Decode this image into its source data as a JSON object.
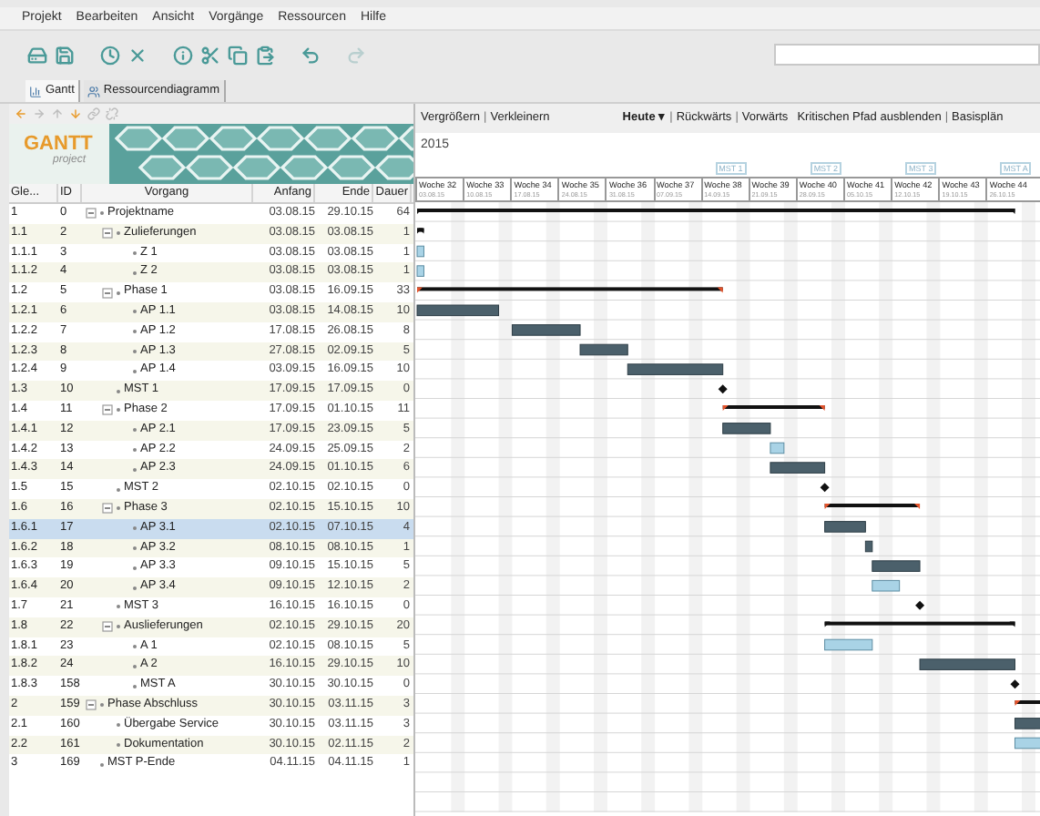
{
  "menu": [
    "Projekt",
    "Bearbeiten",
    "Ansicht",
    "Vorgänge",
    "Ressourcen",
    "Hilfe"
  ],
  "toolbar": [
    {
      "kind": "save-all",
      "disabled": false
    },
    {
      "kind": "save",
      "disabled": false
    },
    {
      "kind": "clock",
      "disabled": false
    },
    {
      "kind": "delete",
      "disabled": false
    },
    {
      "kind": "info",
      "disabled": false
    },
    {
      "kind": "cut",
      "disabled": false
    },
    {
      "kind": "copy",
      "disabled": false
    },
    {
      "kind": "paste",
      "disabled": false
    },
    {
      "kind": "undo",
      "disabled": false
    },
    {
      "kind": "redo",
      "disabled": true
    }
  ],
  "tabs": [
    {
      "label": "Gantt",
      "kind": "gantt",
      "selected": true
    },
    {
      "label": "Ressourcendiagramm",
      "kind": "resource",
      "selected": false
    }
  ],
  "tree_toolbar": [
    {
      "kind": "outdent",
      "disabled": false
    },
    {
      "kind": "indent",
      "disabled": true
    },
    {
      "kind": "up",
      "disabled": true
    },
    {
      "kind": "down",
      "disabled": false
    },
    {
      "kind": "link",
      "disabled": true
    },
    {
      "kind": "unlink",
      "disabled": true
    }
  ],
  "logo": {
    "title": "GANTT",
    "subtitle": "project"
  },
  "table": {
    "columns": [
      "Gle...",
      "ID",
      "Vorgang",
      "Anfang",
      "Ende",
      "Dauer"
    ],
    "rows": [
      {
        "wbs": "1",
        "id": "0",
        "name": "Projektname",
        "start": "03.08.15",
        "end": "29.10.15",
        "duration": "64",
        "kind": "summary",
        "critical": false,
        "expanded": true,
        "selected": false,
        "children": [
          {
            "wbs": "1.1",
            "id": "2",
            "name": "Zulieferungen",
            "start": "03.08.15",
            "end": "03.08.15",
            "duration": "1",
            "kind": "summary",
            "critical": false,
            "expanded": true,
            "selected": false,
            "children": [
              {
                "wbs": "1.1.1",
                "id": "3",
                "name": "Z 1",
                "start": "03.08.15",
                "end": "03.08.15",
                "duration": "1",
                "kind": "task",
                "critical": false,
                "selected": false
              },
              {
                "wbs": "1.1.2",
                "id": "4",
                "name": "Z 2",
                "start": "03.08.15",
                "end": "03.08.15",
                "duration": "1",
                "kind": "task",
                "critical": false,
                "selected": false
              }
            ]
          },
          {
            "wbs": "1.2",
            "id": "5",
            "name": "Phase 1",
            "start": "03.08.15",
            "end": "16.09.15",
            "duration": "33",
            "kind": "summary",
            "critical": true,
            "expanded": true,
            "selected": false,
            "children": [
              {
                "wbs": "1.2.1",
                "id": "6",
                "name": "AP 1.1",
                "start": "03.08.15",
                "end": "14.08.15",
                "duration": "10",
                "kind": "task",
                "critical": true,
                "selected": false
              },
              {
                "wbs": "1.2.2",
                "id": "7",
                "name": "AP 1.2",
                "start": "17.08.15",
                "end": "26.08.15",
                "duration": "8",
                "kind": "task",
                "critical": true,
                "selected": false
              },
              {
                "wbs": "1.2.3",
                "id": "8",
                "name": "AP 1.3",
                "start": "27.08.15",
                "end": "02.09.15",
                "duration": "5",
                "kind": "task",
                "critical": true,
                "selected": false
              },
              {
                "wbs": "1.2.4",
                "id": "9",
                "name": "AP 1.4",
                "start": "03.09.15",
                "end": "16.09.15",
                "duration": "10",
                "kind": "task",
                "critical": true,
                "selected": false
              }
            ]
          },
          {
            "wbs": "1.3",
            "id": "10",
            "name": "MST 1",
            "start": "17.09.15",
            "end": "17.09.15",
            "duration": "0",
            "kind": "milestone",
            "critical": true,
            "selected": false
          },
          {
            "wbs": "1.4",
            "id": "11",
            "name": "Phase 2",
            "start": "17.09.15",
            "end": "01.10.15",
            "duration": "11",
            "kind": "summary",
            "critical": true,
            "expanded": true,
            "selected": false,
            "children": [
              {
                "wbs": "1.4.1",
                "id": "12",
                "name": "AP 2.1",
                "start": "17.09.15",
                "end": "23.09.15",
                "duration": "5",
                "kind": "task",
                "critical": true,
                "selected": false
              },
              {
                "wbs": "1.4.2",
                "id": "13",
                "name": "AP 2.2",
                "start": "24.09.15",
                "end": "25.09.15",
                "duration": "2",
                "kind": "task",
                "critical": false,
                "selected": false
              },
              {
                "wbs": "1.4.3",
                "id": "14",
                "name": "AP 2.3",
                "start": "24.09.15",
                "end": "01.10.15",
                "duration": "6",
                "kind": "task",
                "critical": true,
                "selected": false
              }
            ]
          },
          {
            "wbs": "1.5",
            "id": "15",
            "name": "MST 2",
            "start": "02.10.15",
            "end": "02.10.15",
            "duration": "0",
            "kind": "milestone",
            "critical": true,
            "selected": false
          },
          {
            "wbs": "1.6",
            "id": "16",
            "name": "Phase 3",
            "start": "02.10.15",
            "end": "15.10.15",
            "duration": "10",
            "kind": "summary",
            "critical": true,
            "expanded": true,
            "selected": false,
            "children": [
              {
                "wbs": "1.6.1",
                "id": "17",
                "name": "AP 3.1",
                "start": "02.10.15",
                "end": "07.10.15",
                "duration": "4",
                "kind": "task",
                "critical": true,
                "selected": true
              },
              {
                "wbs": "1.6.2",
                "id": "18",
                "name": "AP 3.2",
                "start": "08.10.15",
                "end": "08.10.15",
                "duration": "1",
                "kind": "task",
                "critical": true,
                "selected": false
              },
              {
                "wbs": "1.6.3",
                "id": "19",
                "name": "AP 3.3",
                "start": "09.10.15",
                "end": "15.10.15",
                "duration": "5",
                "kind": "task",
                "critical": true,
                "selected": false
              },
              {
                "wbs": "1.6.4",
                "id": "20",
                "name": "AP 3.4",
                "start": "09.10.15",
                "end": "12.10.15",
                "duration": "2",
                "kind": "task",
                "critical": false,
                "selected": false
              }
            ]
          },
          {
            "wbs": "1.7",
            "id": "21",
            "name": "MST 3",
            "start": "16.10.15",
            "end": "16.10.15",
            "duration": "0",
            "kind": "milestone",
            "critical": true,
            "selected": false
          },
          {
            "wbs": "1.8",
            "id": "22",
            "name": "Auslieferungen",
            "start": "02.10.15",
            "end": "29.10.15",
            "duration": "20",
            "kind": "summary",
            "critical": false,
            "expanded": true,
            "selected": false,
            "children": [
              {
                "wbs": "1.8.1",
                "id": "23",
                "name": "A 1",
                "start": "02.10.15",
                "end": "08.10.15",
                "duration": "5",
                "kind": "task",
                "critical": false,
                "selected": false
              },
              {
                "wbs": "1.8.2",
                "id": "24",
                "name": "A 2",
                "start": "16.10.15",
                "end": "29.10.15",
                "duration": "10",
                "kind": "task",
                "critical": true,
                "selected": false
              },
              {
                "wbs": "1.8.3",
                "id": "158",
                "name": "MST A",
                "start": "30.10.15",
                "end": "30.10.15",
                "duration": "0",
                "kind": "milestone",
                "critical": true,
                "selected": false
              }
            ]
          }
        ]
      },
      {
        "wbs": "2",
        "id": "159",
        "name": "Phase Abschluss",
        "start": "30.10.15",
        "end": "03.11.15",
        "duration": "3",
        "kind": "summary",
        "critical": true,
        "expanded": true,
        "selected": false,
        "children": [
          {
            "wbs": "2.1",
            "id": "160",
            "name": "Übergabe Service",
            "start": "30.10.15",
            "end": "03.11.15",
            "duration": "3",
            "kind": "task",
            "critical": true,
            "selected": false
          },
          {
            "wbs": "2.2",
            "id": "161",
            "name": "Dokumentation",
            "start": "30.10.15",
            "end": "02.11.15",
            "duration": "2",
            "kind": "task",
            "critical": false,
            "selected": false
          }
        ]
      },
      {
        "wbs": "3",
        "id": "169",
        "name": "MST P-Ende",
        "start": "04.11.15",
        "end": "04.11.15",
        "duration": "1",
        "kind": "milestone",
        "selected": false
      }
    ]
  },
  "gantt": {
    "toolbar_left": [
      "Vergrößern",
      "Verkleinern"
    ],
    "today": "Heute ▾",
    "toolbar_right": [
      "Rückwärts",
      "Vorwärts"
    ],
    "critical_path": "Kritischen Pfad ausblenden",
    "baselines": "Basisplän",
    "separator": "|",
    "year": "2015",
    "weeks": [
      {
        "label": "Woche 32",
        "date": "03.08.15"
      },
      {
        "label": "Woche 33",
        "date": "10.08.15"
      },
      {
        "label": "Woche 34",
        "date": "17.08.15"
      },
      {
        "label": "Woche 35",
        "date": "24.08.15"
      },
      {
        "label": "Woche 36",
        "date": "31.08.15"
      },
      {
        "label": "Woche 37",
        "date": "07.09.15"
      },
      {
        "label": "Woche 38",
        "date": "14.09.15",
        "milestone": "MST 1"
      },
      {
        "label": "Woche 39",
        "date": "21.09.15"
      },
      {
        "label": "Woche 40",
        "date": "28.09.15",
        "milestone": "MST 2"
      },
      {
        "label": "Woche 41",
        "date": "05.10.15"
      },
      {
        "label": "Woche 42",
        "date": "12.10.15",
        "milestone": "MST 3"
      },
      {
        "label": "Woche 43",
        "date": "19.10.15"
      },
      {
        "label": "Woche 44",
        "date": "26.10.15",
        "milestone": "MST A"
      }
    ]
  }
}
